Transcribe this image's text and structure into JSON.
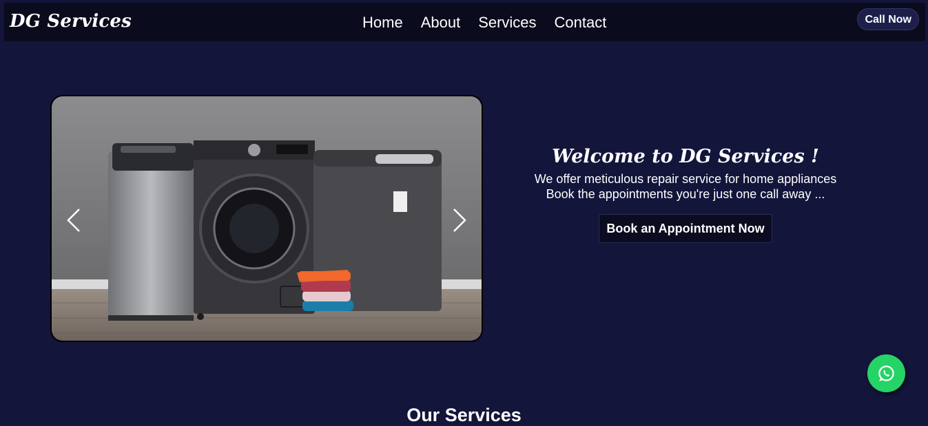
{
  "brand": {
    "logo_text": "DG Services"
  },
  "nav": {
    "links": [
      "Home",
      "About",
      "Services",
      "Contact"
    ],
    "call_label": "Call Now"
  },
  "carousel": {
    "image_alt": "washing machines with folded towels",
    "prev_icon": "chevron-left-icon",
    "next_icon": "chevron-right-icon"
  },
  "hero": {
    "title": "Welcome to DG Services !",
    "line1": "We offer meticulous repair service for home appliances",
    "line2": "Book the appointments you're just one call away ...",
    "cta_label": "Book an Appointment Now"
  },
  "services": {
    "heading": "Our Services"
  },
  "floating": {
    "icon": "whatsapp-icon",
    "color": "#25d366"
  },
  "colors": {
    "background": "#13153a",
    "navbar": "#0a0b1d"
  }
}
